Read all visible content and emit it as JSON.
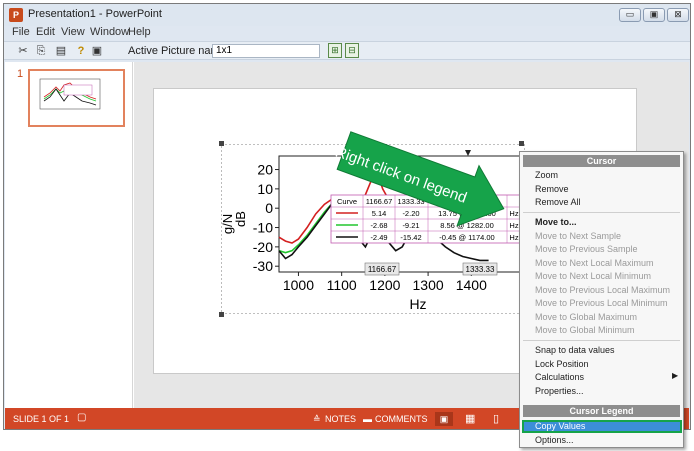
{
  "window": {
    "app_icon": "P",
    "title": "Presentation1 - PowerPoint",
    "controls": {
      "minimize": "▭",
      "restore": "▣",
      "close": "⊠"
    }
  },
  "menu": [
    "File",
    "Edit",
    "View",
    "Window",
    "Help"
  ],
  "toolbar": {
    "icons": [
      "cut-icon",
      "copy-icon",
      "paste-icon",
      "help-icon",
      "insert-icon"
    ],
    "active_picture_label": "Active Picture name:",
    "active_picture_value": "1x1",
    "buttons": [
      "add-picture-icon",
      "remove-picture-icon"
    ]
  },
  "thumbnails": {
    "slide_number": "1"
  },
  "annotation": {
    "text": "Right click on legend"
  },
  "chart_data": {
    "type": "line",
    "xlabel": "Hz",
    "ylabel_top": "g/N",
    "ylabel_bottom": "dB",
    "xlim": [
      955,
      1515
    ],
    "ylim": [
      -33,
      27
    ],
    "x_ticks": [
      1000,
      1100,
      1200,
      1300,
      1400
    ],
    "y_ticks": [
      20,
      10,
      0,
      -10,
      -20,
      -30
    ],
    "cursor_labels": [
      "1166.67",
      "1333.33"
    ],
    "series": [
      {
        "color": "#d42020",
        "x": [
          955,
          970,
          985,
          1000,
          1020,
          1040,
          1060,
          1080,
          1095,
          1110,
          1125,
          1140,
          1155,
          1166,
          1180,
          1195,
          1210,
          1225,
          1240,
          1260,
          1282,
          1300,
          1320,
          1340,
          1360,
          1380,
          1400,
          1420,
          1440
        ],
        "y": [
          -15,
          -17,
          -18,
          -16,
          -10,
          -3,
          2,
          5,
          1,
          -3,
          -2,
          2,
          7,
          13,
          20,
          10,
          4,
          -1,
          -3,
          5,
          13.75,
          6,
          0,
          -6,
          -10,
          -12,
          -13,
          -13,
          -14
        ]
      },
      {
        "color": "#22c52e",
        "x": [
          955,
          970,
          985,
          1000,
          1020,
          1040,
          1060,
          1080,
          1095,
          1110,
          1125,
          1140,
          1155,
          1166,
          1180,
          1195,
          1210,
          1225,
          1240,
          1260,
          1282,
          1300,
          1320,
          1340,
          1360,
          1380,
          1400,
          1420,
          1440
        ],
        "y": [
          -22,
          -23,
          -22,
          -19,
          -14,
          -8,
          -2,
          3,
          0,
          -4,
          -6,
          -5,
          -3,
          0,
          1,
          -2,
          -5,
          -3,
          0,
          5,
          8.56,
          4,
          -2,
          -7,
          -11,
          -14,
          -15,
          -16,
          -17
        ]
      },
      {
        "color": "#111111",
        "x": [
          955,
          970,
          985,
          1000,
          1020,
          1040,
          1060,
          1080,
          1095,
          1110,
          1125,
          1140,
          1155,
          1166,
          1174,
          1180,
          1195,
          1210,
          1225,
          1240,
          1260,
          1282,
          1300,
          1320,
          1340,
          1360,
          1380,
          1400,
          1420,
          1440
        ],
        "y": [
          -22,
          -26,
          -24,
          -20,
          -15,
          -9,
          -3,
          3,
          0,
          -5,
          -10,
          -16,
          -20,
          -15,
          -0.45,
          -8,
          -12,
          -18,
          -22,
          -20,
          -12,
          -6,
          -10,
          -16,
          -20,
          -23,
          -25,
          -26,
          -27,
          -27
        ]
      }
    ],
    "legend_table": {
      "headers": [
        "Curve",
        "1166.67",
        "1333.33",
        "Max",
        "",
        "dB"
      ],
      "rows": [
        {
          "color": "#d42020",
          "v1": "5.14",
          "v2": "-2.20",
          "max": "13.75 @ 1282.00",
          "unit": "Hz",
          "db": "dB"
        },
        {
          "color": "#22c52e",
          "v1": "-2.68",
          "v2": "-9.21",
          "max": "8.56 @ 1282.00",
          "unit": "Hz",
          "db": "dB"
        },
        {
          "color": "#111111",
          "v1": "-2.49",
          "v2": "-15.42",
          "max": "-0.45 @ 1174.00",
          "unit": "Hz",
          "db": "dB"
        }
      ]
    }
  },
  "status_bar": {
    "slide_info": "SLIDE 1 OF 1",
    "notes_label": "NOTES",
    "comments_label": "COMMENTS"
  },
  "context_menu": {
    "header_cursor": "Cursor",
    "cursor_items": [
      {
        "label": "Zoom",
        "enabled": true
      },
      {
        "label": "Remove",
        "enabled": true
      },
      {
        "label": "Remove All",
        "enabled": true
      }
    ],
    "move_to_label": "Move to...",
    "move_items": [
      {
        "label": "Move to Next Sample",
        "enabled": false
      },
      {
        "label": "Move to Previous Sample",
        "enabled": false
      },
      {
        "label": "Move to Next Local Maximum",
        "enabled": false
      },
      {
        "label": "Move to Next Local Minimum",
        "enabled": false
      },
      {
        "label": "Move to Previous Local Maximum",
        "enabled": false
      },
      {
        "label": "Move to Previous Local Minimum",
        "enabled": false
      },
      {
        "label": "Move to Global Maximum",
        "enabled": false
      },
      {
        "label": "Move to Global Minimum",
        "enabled": false
      }
    ],
    "other_items": [
      {
        "label": "Snap to data values",
        "enabled": true
      },
      {
        "label": "Lock Position",
        "enabled": true
      },
      {
        "label": "Calculations",
        "enabled": true,
        "submenu": true
      },
      {
        "label": "Properties...",
        "enabled": true
      }
    ],
    "header_legend": "Cursor Legend",
    "legend_items": [
      {
        "label": "Copy Values",
        "enabled": true,
        "highlighted": true
      },
      {
        "label": "Options...",
        "enabled": true
      }
    ]
  },
  "colors": {
    "accent_orange": "#d24726",
    "highlight_green": "#16a34a",
    "arrow_green": "#16a34a"
  }
}
